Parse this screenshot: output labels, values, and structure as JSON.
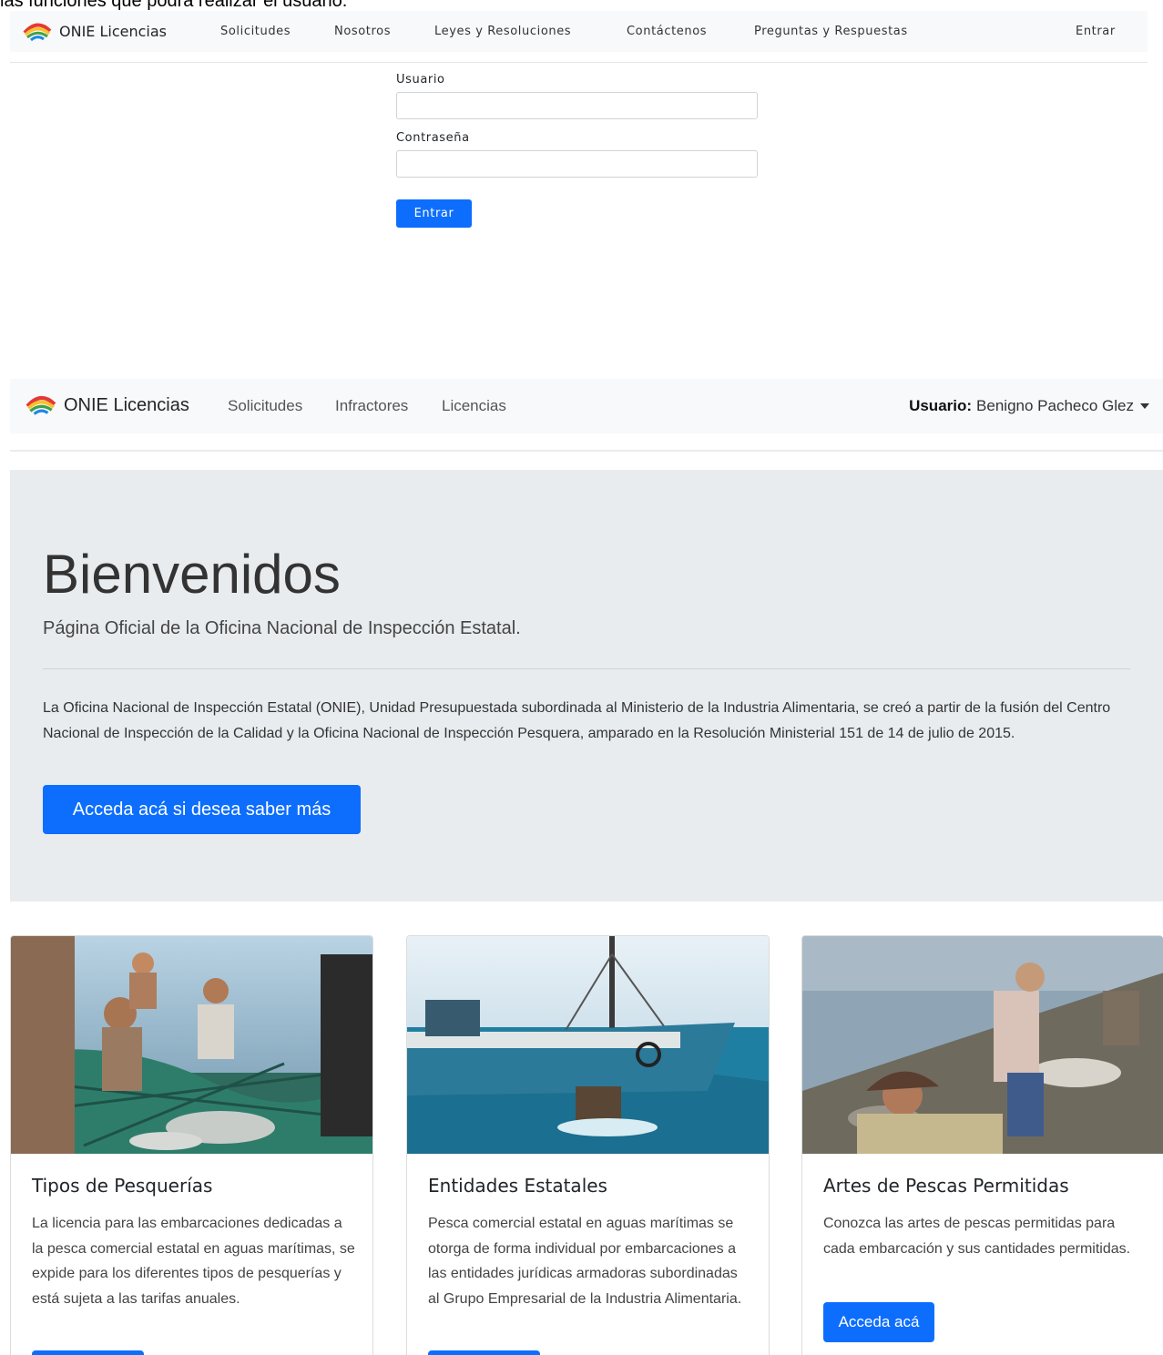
{
  "top_cut_text": "las funciones que podrá realizar el usuario.",
  "nav_public": {
    "brand": "ONIE Licencias",
    "links": [
      "Solicitudes",
      "Nosotros",
      "Leyes y Resoluciones",
      "Contáctenos",
      "Preguntas y Respuestas"
    ],
    "login_link": "Entrar"
  },
  "login_form": {
    "user_label": "Usuario",
    "user_value": "",
    "password_label": "Contraseña",
    "password_value": "",
    "submit_label": "Entrar"
  },
  "nav_user": {
    "brand": "ONIE Licencias",
    "links": [
      "Solicitudes",
      "Infractores",
      "Licencias"
    ],
    "user_prefix": "Usuario:",
    "user_name": "Benigno Pacheco Glez"
  },
  "jumbotron": {
    "title": "Bienvenidos",
    "lead": "Página Oficial de la Oficina Nacional de Inspección Estatal.",
    "text": "La Oficina Nacional de Inspección Estatal (ONIE), Unidad Presupuestada subordinada al Ministerio de la Industria Alimentaria, se creó a partir de la fusión del Centro Nacional de Inspección de la Calidad y la Oficina Nacional de Inspección Pesquera, amparado en la Resolución Ministerial 151 de 14 de julio de 2015.",
    "button": "Acceda acá si desea saber más"
  },
  "cards": [
    {
      "title": "Tipos de Pesquerías",
      "text": "La licencia para las embarcaciones dedicadas a la pesca comercial estatal en aguas marítimas, se expide para los diferentes tipos de pesquerías y está sujeta a las tarifas anuales.",
      "button": ""
    },
    {
      "title": "Entidades Estatales",
      "text": "Pesca comercial estatal en aguas marítimas se otorga de forma individual por embarcaciones a las entidades jurídicas armadoras subordinadas al Grupo Empresarial de la Industria Alimentaria.",
      "button": ""
    },
    {
      "title": "Artes de Pescas Permitidas",
      "text": "Conozca las artes de pescas permitidas para cada embarcación y sus cantidades permitidas.",
      "button": "Acceda acá"
    }
  ],
  "colors": {
    "primary": "#0d6efd",
    "navbar_bg": "#f8f9fa",
    "jumbotron_bg": "#e9ecef"
  }
}
